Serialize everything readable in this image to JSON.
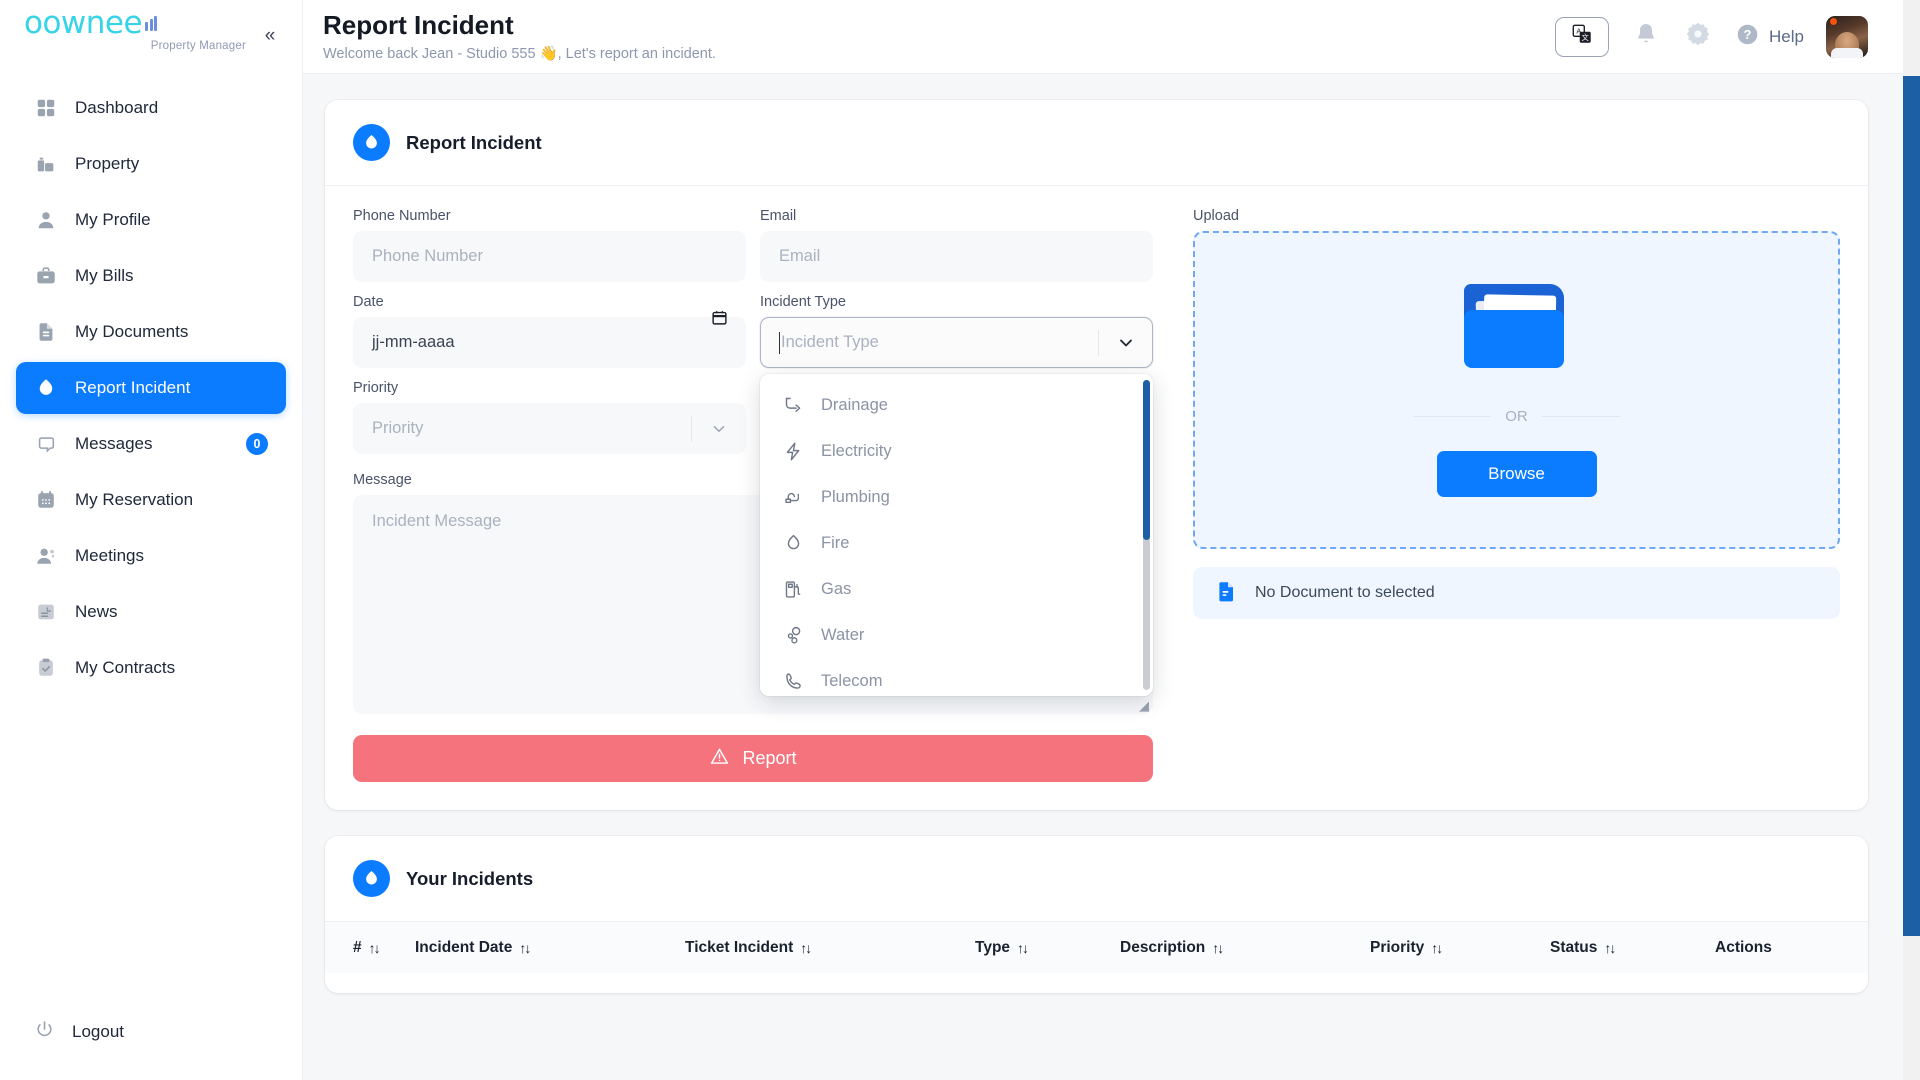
{
  "brand": {
    "name": "oownee",
    "tagline": "Property Manager"
  },
  "sidebar": {
    "collapse_icon": "chevron-double-left-icon",
    "items": [
      {
        "label": "Dashboard",
        "icon": "grid-icon",
        "active": false,
        "badge": null
      },
      {
        "label": "Property",
        "icon": "building-icon",
        "active": false,
        "badge": null
      },
      {
        "label": "My Profile",
        "icon": "user-icon",
        "active": false,
        "badge": null
      },
      {
        "label": "My Bills",
        "icon": "briefcase-icon",
        "active": false,
        "badge": null
      },
      {
        "label": "My Documents",
        "icon": "document-icon",
        "active": false,
        "badge": null
      },
      {
        "label": "Report Incident",
        "icon": "flame-icon",
        "active": true,
        "badge": null
      },
      {
        "label": "Messages",
        "icon": "chat-icon",
        "active": false,
        "badge": "0"
      },
      {
        "label": "My Reservation",
        "icon": "calendar-icon",
        "active": false,
        "badge": null
      },
      {
        "label": "Meetings",
        "icon": "users-icon",
        "active": false,
        "badge": null
      },
      {
        "label": "News",
        "icon": "news-icon",
        "active": false,
        "badge": null
      },
      {
        "label": "My Contracts",
        "icon": "clipboard-check-icon",
        "active": false,
        "badge": null
      }
    ],
    "logout": {
      "label": "Logout",
      "icon": "power-icon"
    }
  },
  "header": {
    "title": "Report Incident",
    "subtitle": "Welcome back Jean - Studio 555 👋, Let's report an incident.",
    "translate_icon": "translate-icon",
    "bell_icon": "bell-icon",
    "gear_icon": "gear-icon",
    "help_icon": "question-circle-icon",
    "help_label": "Help",
    "avatar": "user-avatar"
  },
  "form_card": {
    "icon": "flame-icon",
    "title": "Report Incident",
    "fields": {
      "phone": {
        "label": "Phone Number",
        "placeholder": "Phone Number",
        "value": ""
      },
      "email": {
        "label": "Email",
        "placeholder": "Email",
        "value": ""
      },
      "date": {
        "label": "Date",
        "placeholder": "jj-mm-aaaa",
        "value": ""
      },
      "incident_type": {
        "label": "Incident Type",
        "placeholder": "Incident Type",
        "value": ""
      },
      "priority": {
        "label": "Priority",
        "placeholder": "Priority",
        "value": ""
      },
      "message": {
        "label": "Message",
        "placeholder": "Incident Message",
        "value": ""
      }
    },
    "incident_type_options": [
      {
        "label": "Drainage",
        "icon": "pipe-icon"
      },
      {
        "label": "Electricity",
        "icon": "bolt-icon"
      },
      {
        "label": "Plumbing",
        "icon": "faucet-icon"
      },
      {
        "label": "Fire",
        "icon": "flame-outline-icon"
      },
      {
        "label": "Gas",
        "icon": "gas-pump-icon"
      },
      {
        "label": "Water",
        "icon": "water-drops-icon"
      },
      {
        "label": "Telecom",
        "icon": "phone-icon"
      }
    ],
    "submit": {
      "label": "Report",
      "icon": "warning-triangle-icon",
      "color": "#f4737d"
    }
  },
  "upload": {
    "label": "Upload",
    "folder_icon": "folder-icon",
    "or_text": "OR",
    "browse_label": "Browse",
    "status_text": "No Document to selected",
    "status_icon": "file-icon"
  },
  "incidents_card": {
    "icon": "flame-icon",
    "title": "Your Incidents",
    "columns": [
      {
        "label": "#",
        "sortable": true
      },
      {
        "label": "Incident Date",
        "sortable": true
      },
      {
        "label": "Ticket Incident",
        "sortable": true
      },
      {
        "label": "Type",
        "sortable": true
      },
      {
        "label": "Description",
        "sortable": true
      },
      {
        "label": "Priority",
        "sortable": true
      },
      {
        "label": "Status",
        "sortable": true
      },
      {
        "label": "Actions",
        "sortable": false
      }
    ],
    "sort_glyph": "↑↓",
    "rows": []
  },
  "colors": {
    "accent": "#0b7bff",
    "brand_cyan": "#37d4e8",
    "danger": "#f4737d",
    "scrollbar": "#1d5fa5"
  }
}
